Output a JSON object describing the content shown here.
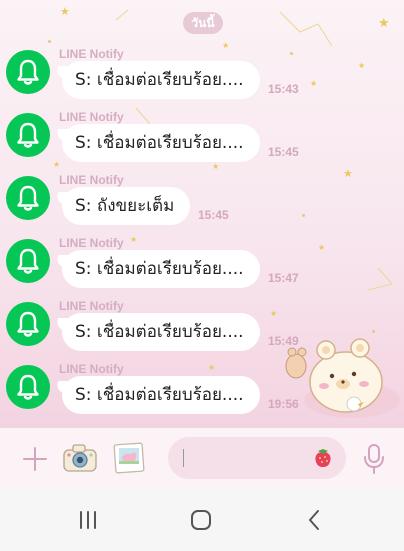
{
  "chat": {
    "date_label": "วันนี้",
    "messages": [
      {
        "sender": "LINE Notify",
        "text": "S: เชื่อมต่อเรียบร้อย....",
        "time": "15:43"
      },
      {
        "sender": "LINE Notify",
        "text": "S: เชื่อมต่อเรียบร้อย....",
        "time": "15:45"
      },
      {
        "sender": "LINE Notify",
        "text": "S: ถังขยะเต็ม",
        "time": "15:45"
      },
      {
        "sender": "LINE Notify",
        "text": "S: เชื่อมต่อเรียบร้อย....",
        "time": "15:47"
      },
      {
        "sender": "LINE Notify",
        "text": "S: เชื่อมต่อเรียบร้อย....",
        "time": "15:49"
      },
      {
        "sender": "LINE Notify",
        "text": "S: เชื่อมต่อเรียบร้อย....",
        "time": "19:56"
      }
    ]
  },
  "icons": {
    "avatar": "bell-icon",
    "plus": "plus-icon",
    "camera": "camera-icon",
    "gallery": "photo-icon",
    "sticker": "strawberry-icon",
    "voice": "microphone-icon",
    "nav_recents": "recents-icon",
    "nav_home": "home-icon",
    "nav_back": "back-icon"
  },
  "colors": {
    "avatar_bg": "#06c755",
    "sender": "#d5adc2",
    "time": "#d4a7bd",
    "bubble": "#ffffff",
    "accent": "#d6a2c2"
  }
}
